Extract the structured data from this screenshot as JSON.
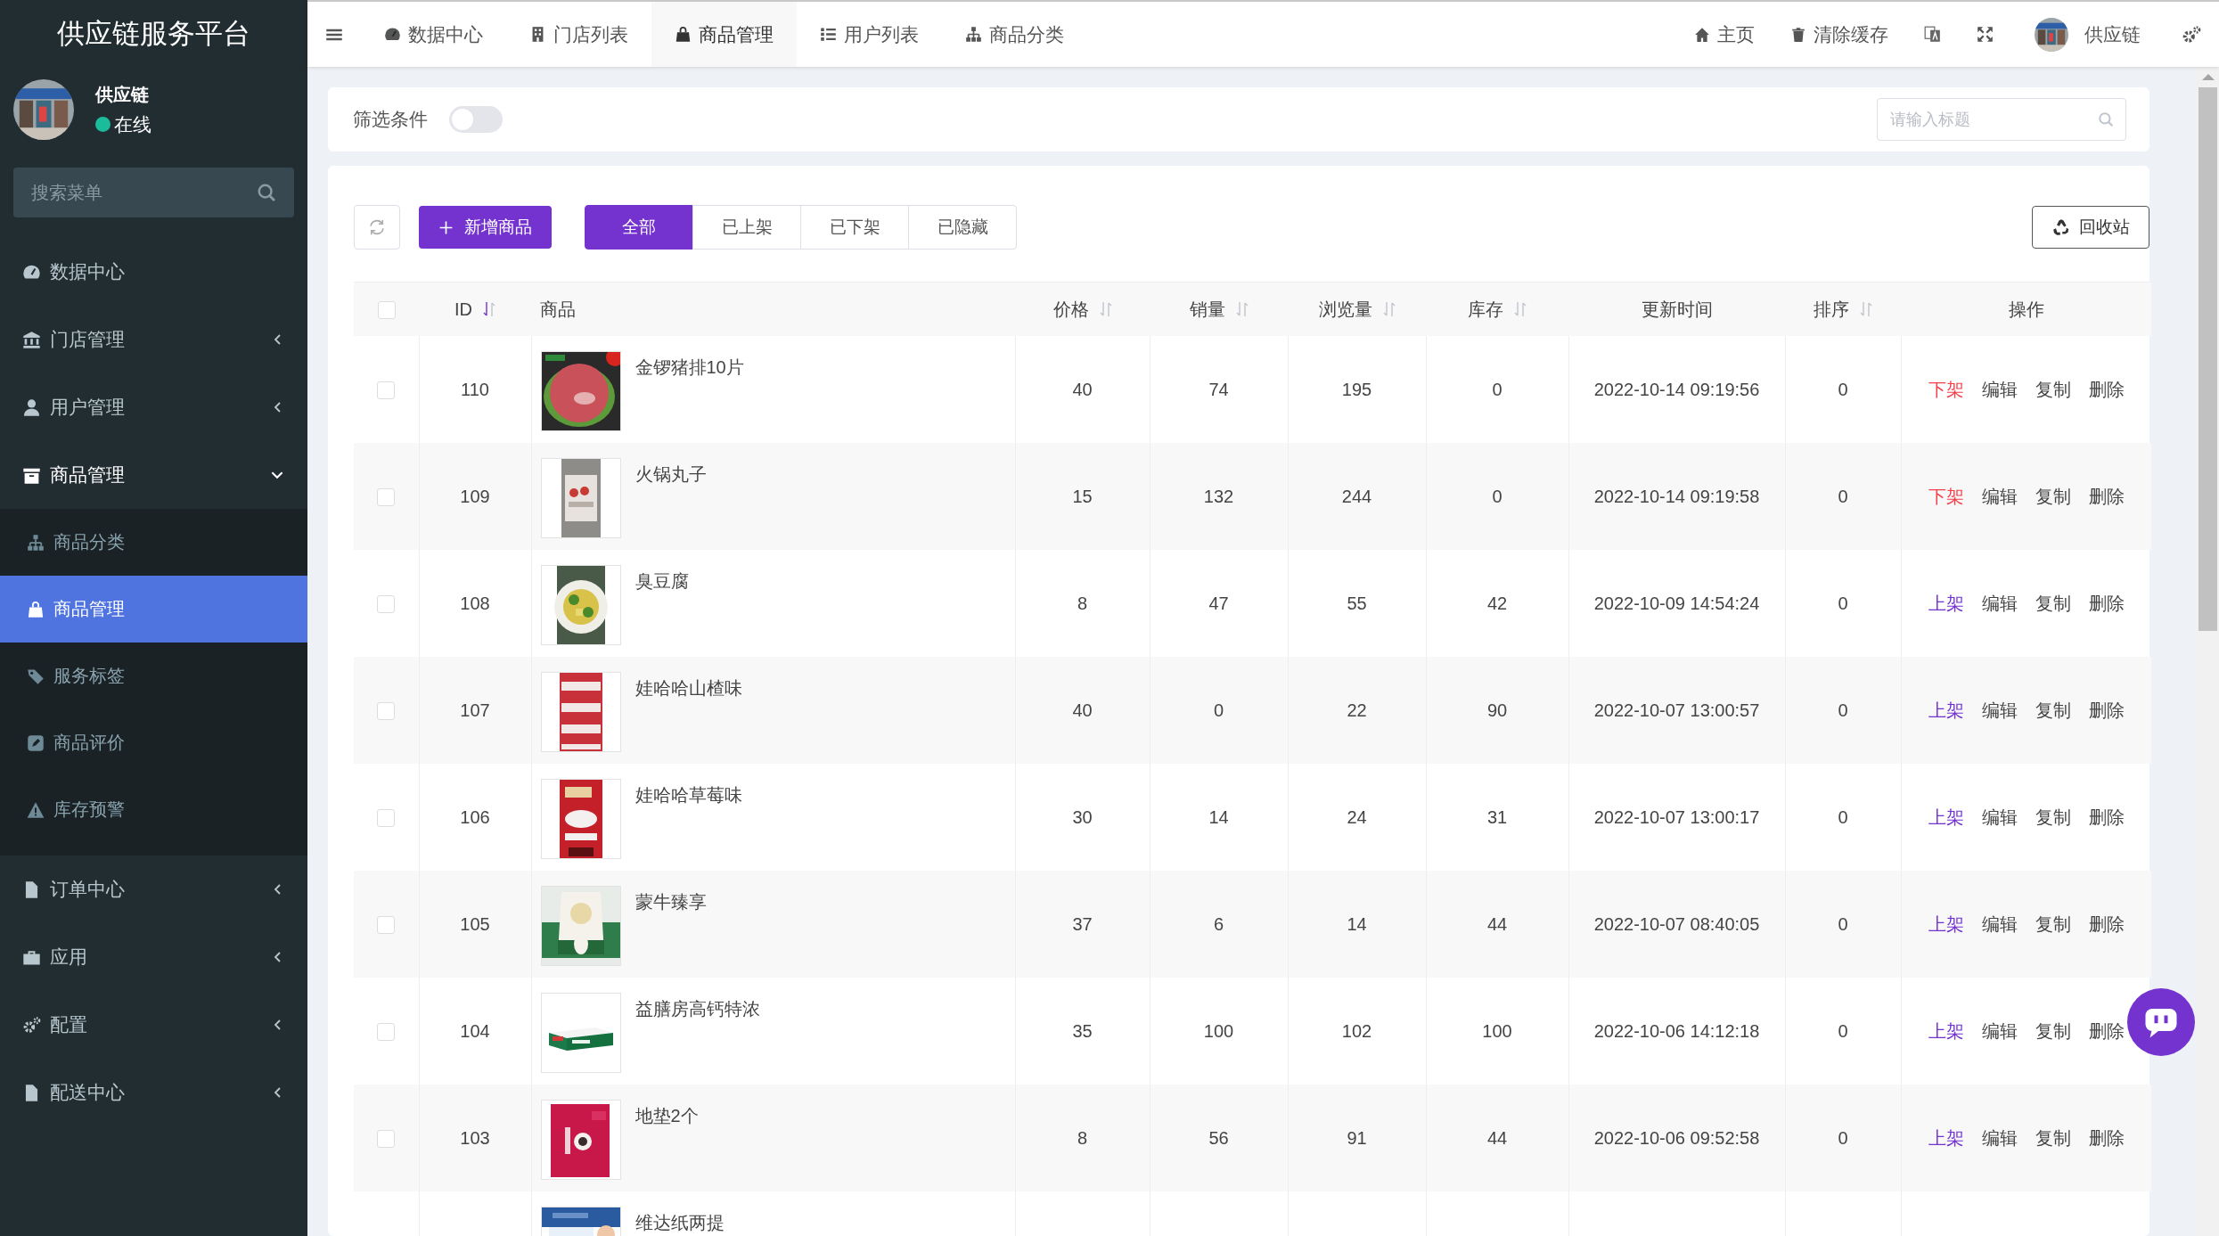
{
  "sidebar": {
    "title": "供应链服务平台",
    "user": {
      "name": "供应链",
      "status": "在线",
      "online": true
    },
    "search": {
      "placeholder": "搜索菜单"
    },
    "menu": [
      {
        "label": "数据中心",
        "kind": "link"
      },
      {
        "label": "门店管理",
        "kind": "group",
        "expanded": false
      },
      {
        "label": "用户管理",
        "kind": "group",
        "expanded": false
      },
      {
        "label": "商品管理",
        "kind": "group",
        "expanded": true,
        "children": [
          {
            "label": "商品分类",
            "selected": false
          },
          {
            "label": "商品管理",
            "selected": true
          },
          {
            "label": "服务标签",
            "selected": false
          },
          {
            "label": "商品评价",
            "selected": false
          },
          {
            "label": "库存预警",
            "selected": false
          }
        ]
      },
      {
        "label": "订单中心",
        "kind": "group",
        "expanded": false
      },
      {
        "label": "应用",
        "kind": "group",
        "expanded": false
      },
      {
        "label": "配置",
        "kind": "group",
        "expanded": false
      },
      {
        "label": "配送中心",
        "kind": "group",
        "expanded": false
      }
    ]
  },
  "topbar": {
    "tabs": [
      {
        "label": "数据中心",
        "selected": false
      },
      {
        "label": "门店列表",
        "selected": false
      },
      {
        "label": "商品管理",
        "selected": true
      },
      {
        "label": "用户列表",
        "selected": false
      },
      {
        "label": "商品分类",
        "selected": false
      }
    ],
    "links": [
      "主页",
      "清除缓存"
    ],
    "user": "供应链"
  },
  "filter": {
    "label": "筛选条件",
    "on": false,
    "search": {
      "placeholder": "请输入标题"
    }
  },
  "toolbar": {
    "add_button": "新增商品",
    "status_tabs": [
      {
        "label": "全部",
        "selected": true
      },
      {
        "label": "已上架",
        "selected": false
      },
      {
        "label": "已下架",
        "selected": false
      },
      {
        "label": "已隐藏",
        "selected": false
      }
    ],
    "recycle_button": "回收站"
  },
  "table": {
    "select_all": false,
    "columns": [
      {
        "label": "ID",
        "sorted": true
      },
      {
        "label": "商品"
      },
      {
        "label": "价格",
        "sorted": false
      },
      {
        "label": "销量",
        "sorted": false
      },
      {
        "label": "浏览量",
        "sorted": false
      },
      {
        "label": "库存",
        "sorted": false
      },
      {
        "label": "更新时间"
      },
      {
        "label": "排序",
        "sorted": false
      },
      {
        "label": "操作"
      }
    ],
    "rows": [
      {
        "checked": false,
        "id": "110",
        "name": "金锣猪排10片",
        "price": "40",
        "sales": "74",
        "views": "195",
        "stock": "0",
        "updated": "2022-10-14 09:19:56",
        "order": "0",
        "actions": [
          {
            "label": "下架",
            "kind": "unlist"
          },
          {
            "label": "编辑",
            "kind": "plain"
          },
          {
            "label": "复制",
            "kind": "plain"
          },
          {
            "label": "删除",
            "kind": "plain"
          }
        ]
      },
      {
        "checked": false,
        "id": "109",
        "name": "火锅丸子",
        "price": "15",
        "sales": "132",
        "views": "244",
        "stock": "0",
        "updated": "2022-10-14 09:19:58",
        "order": "0",
        "actions": [
          {
            "label": "下架",
            "kind": "unlist"
          },
          {
            "label": "编辑",
            "kind": "plain"
          },
          {
            "label": "复制",
            "kind": "plain"
          },
          {
            "label": "删除",
            "kind": "plain"
          }
        ]
      },
      {
        "checked": false,
        "id": "108",
        "name": "臭豆腐",
        "price": "8",
        "sales": "47",
        "views": "55",
        "stock": "42",
        "updated": "2022-10-09 14:54:24",
        "order": "0",
        "actions": [
          {
            "label": "上架",
            "kind": "list"
          },
          {
            "label": "编辑",
            "kind": "plain"
          },
          {
            "label": "复制",
            "kind": "plain"
          },
          {
            "label": "删除",
            "kind": "plain"
          }
        ]
      },
      {
        "checked": false,
        "id": "107",
        "name": "娃哈哈山楂味",
        "price": "40",
        "sales": "0",
        "views": "22",
        "stock": "90",
        "updated": "2022-10-07 13:00:57",
        "order": "0",
        "actions": [
          {
            "label": "上架",
            "kind": "list"
          },
          {
            "label": "编辑",
            "kind": "plain"
          },
          {
            "label": "复制",
            "kind": "plain"
          },
          {
            "label": "删除",
            "kind": "plain"
          }
        ]
      },
      {
        "checked": false,
        "id": "106",
        "name": "娃哈哈草莓味",
        "price": "30",
        "sales": "14",
        "views": "24",
        "stock": "31",
        "updated": "2022-10-07 13:00:17",
        "order": "0",
        "actions": [
          {
            "label": "上架",
            "kind": "list"
          },
          {
            "label": "编辑",
            "kind": "plain"
          },
          {
            "label": "复制",
            "kind": "plain"
          },
          {
            "label": "删除",
            "kind": "plain"
          }
        ]
      },
      {
        "checked": false,
        "id": "105",
        "name": "蒙牛臻享",
        "price": "37",
        "sales": "6",
        "views": "14",
        "stock": "44",
        "updated": "2022-10-07 08:40:05",
        "order": "0",
        "actions": [
          {
            "label": "上架",
            "kind": "list"
          },
          {
            "label": "编辑",
            "kind": "plain"
          },
          {
            "label": "复制",
            "kind": "plain"
          },
          {
            "label": "删除",
            "kind": "plain"
          }
        ]
      },
      {
        "checked": false,
        "id": "104",
        "name": "益膳房高钙特浓",
        "price": "35",
        "sales": "100",
        "views": "102",
        "stock": "100",
        "updated": "2022-10-06 14:12:18",
        "order": "0",
        "actions": [
          {
            "label": "上架",
            "kind": "list"
          },
          {
            "label": "编辑",
            "kind": "plain"
          },
          {
            "label": "复制",
            "kind": "plain"
          },
          {
            "label": "删除",
            "kind": "plain"
          }
        ]
      },
      {
        "checked": false,
        "id": "103",
        "name": "地垫2个",
        "price": "8",
        "sales": "56",
        "views": "91",
        "stock": "44",
        "updated": "2022-10-06 09:52:58",
        "order": "0",
        "actions": [
          {
            "label": "上架",
            "kind": "list"
          },
          {
            "label": "编辑",
            "kind": "plain"
          },
          {
            "label": "复制",
            "kind": "plain"
          },
          {
            "label": "删除",
            "kind": "plain"
          }
        ]
      },
      {
        "name": "维达纸两提"
      }
    ]
  }
}
